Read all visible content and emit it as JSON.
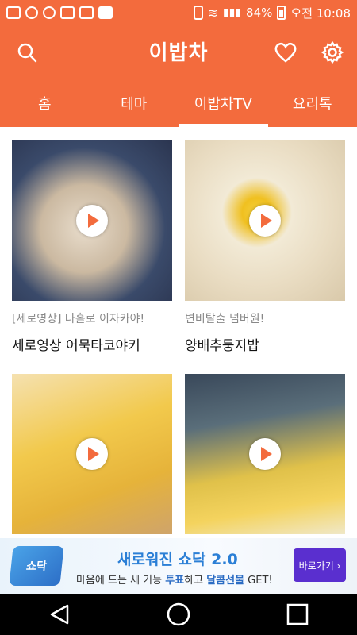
{
  "status_bar": {
    "battery": "84%",
    "time": "오전 10:08"
  },
  "header": {
    "logo": "이밥차",
    "icons": [
      "search-icon",
      "heart-icon",
      "gear-icon"
    ]
  },
  "tabs": [
    {
      "label": "홈",
      "active": false
    },
    {
      "label": "테마",
      "active": false
    },
    {
      "label": "이밥차TV",
      "active": true
    },
    {
      "label": "요리톡",
      "active": false
    }
  ],
  "cards": [
    {
      "subtitle": "[세로영상] 나홀로 이자카야!",
      "title": "세로영상 어묵타코야키"
    },
    {
      "subtitle": "변비탈출 넘버원!",
      "title": "양배추둥지밥"
    },
    {
      "subtitle": "",
      "title": ""
    },
    {
      "subtitle": "",
      "title": ""
    }
  ],
  "ad": {
    "logo": "쇼닥",
    "title": "새로워진 쇼닥 2.0",
    "desc_prefix": "마음에 드는 새 기능 ",
    "desc_vote": "투표",
    "desc_middle": "하고 ",
    "desc_gift": "달콤선물",
    "desc_suffix": " GET!",
    "button": "바로가기 ›"
  },
  "colors": {
    "brand": "#f36b3d",
    "ad_button": "#5a2fcf"
  }
}
